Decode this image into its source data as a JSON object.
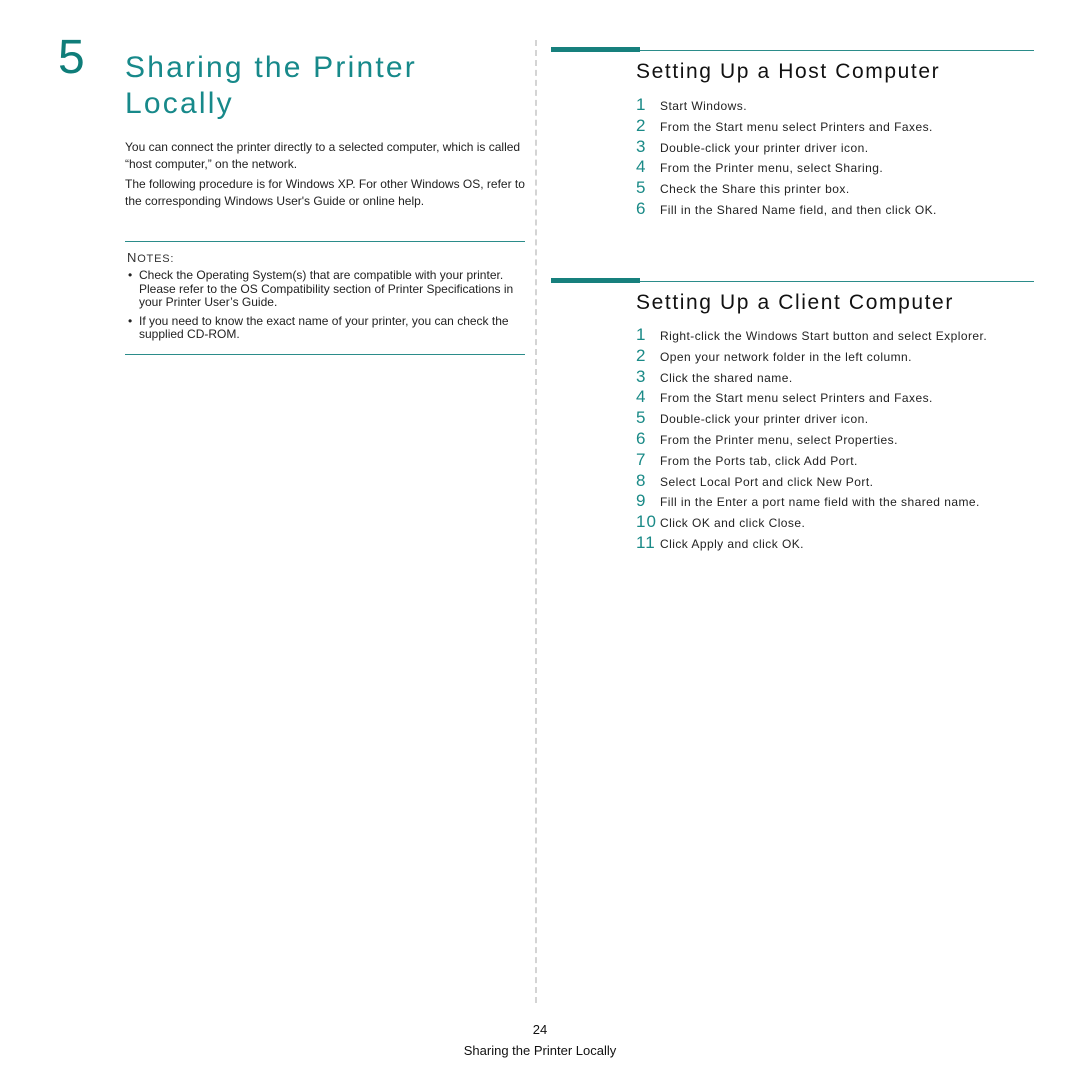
{
  "chapter": {
    "number": "5",
    "title": "Sharing the Printer Locally"
  },
  "intro": {
    "paragraphs": [
      "You can connect the printer directly to a selected computer, which is called “host computer,” on the network.",
      "The following procedure is for Windows XP. For other Windows OS, refer to the corresponding Windows User's Guide or online help."
    ]
  },
  "notes": {
    "title_first": "N",
    "title_rest": "OTES:",
    "items": [
      "Check the Operating System(s) that are compatible with your printer. Please refer to the OS Compatibility section of Printer Specifications in your Printer User’s Guide.",
      "If you need to know the exact name of your printer, you can check the supplied CD-ROM."
    ]
  },
  "host_section": {
    "title": "Setting Up a Host Computer",
    "steps": [
      {
        "num": "1",
        "text": "Start Windows."
      },
      {
        "num": "2",
        "text": "From the Start menu select Printers and Faxes."
      },
      {
        "num": "3",
        "text": "Double-click your printer driver icon."
      },
      {
        "num": "4",
        "text": "From the Printer menu, select Sharing."
      },
      {
        "num": "5",
        "text": "Check the Share this printer box."
      },
      {
        "num": "6",
        "text": "Fill in the Shared Name field, and then click OK."
      }
    ]
  },
  "client_section": {
    "title": "Setting Up a Client Computer",
    "steps": [
      {
        "num": "1",
        "text": "Right-click the Windows Start button and select Explorer."
      },
      {
        "num": "2",
        "text": "Open your network folder in the left column."
      },
      {
        "num": "3",
        "text": "Click the shared name."
      },
      {
        "num": "4",
        "text": "From the Start menu select Printers and Faxes."
      },
      {
        "num": "5",
        "text": "Double-click your printer driver icon."
      },
      {
        "num": "6",
        "text": "From the Printer menu, select Properties."
      },
      {
        "num": "7",
        "text": "From the Ports tab, click Add Port."
      },
      {
        "num": "8",
        "text": "Select Local Port and click New Port."
      },
      {
        "num": "9",
        "text": "Fill in the Enter a port name field with the shared name."
      },
      {
        "num": "10",
        "text": "Click OK and click Close."
      },
      {
        "num": "11",
        "text": "Click Apply and click OK."
      }
    ]
  },
  "footer": {
    "page_number": "24",
    "running_title": "Sharing the Printer Locally"
  },
  "colors": {
    "accent": "#17898a",
    "rule": "#17807d"
  }
}
